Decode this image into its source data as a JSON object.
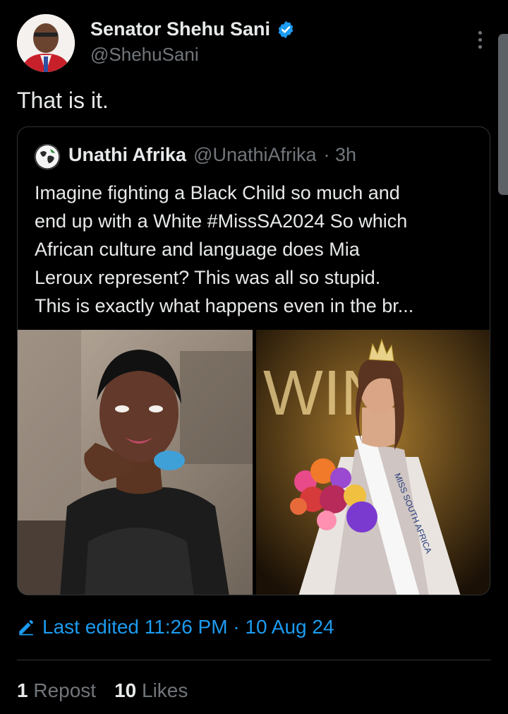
{
  "author": {
    "name": "Senator Shehu Sani",
    "handle": "@ShehuSani",
    "verified_color": "#1d9bf0"
  },
  "tweet": {
    "text": "That is it."
  },
  "quote": {
    "name": "Unathi Afrika",
    "handle": "@UnathiAfrika",
    "time": "· 3h",
    "lines": [
      "Imagine fighting a Black Child so much and",
      "end up with a White #MissSA2024 So which",
      "African culture and language does Mia",
      "Leroux represent? This was all so stupid.",
      "This is exactly what happens even in the br..."
    ],
    "media_right_text": {
      "backdrop": "WIN",
      "sash": "MISS SOUTH AFRICA"
    }
  },
  "edit": {
    "icon": "pencil-icon",
    "text": "Last edited 11:26 PM · 10 Aug 24"
  },
  "stats": {
    "reposts_count": "1",
    "reposts_label": "Repost",
    "likes_count": "10",
    "likes_label": "Likes"
  },
  "colors": {
    "background": "#000000",
    "text": "#e7e9ea",
    "muted": "#71767b",
    "accent": "#1d9bf0",
    "border": "#2f3336"
  }
}
